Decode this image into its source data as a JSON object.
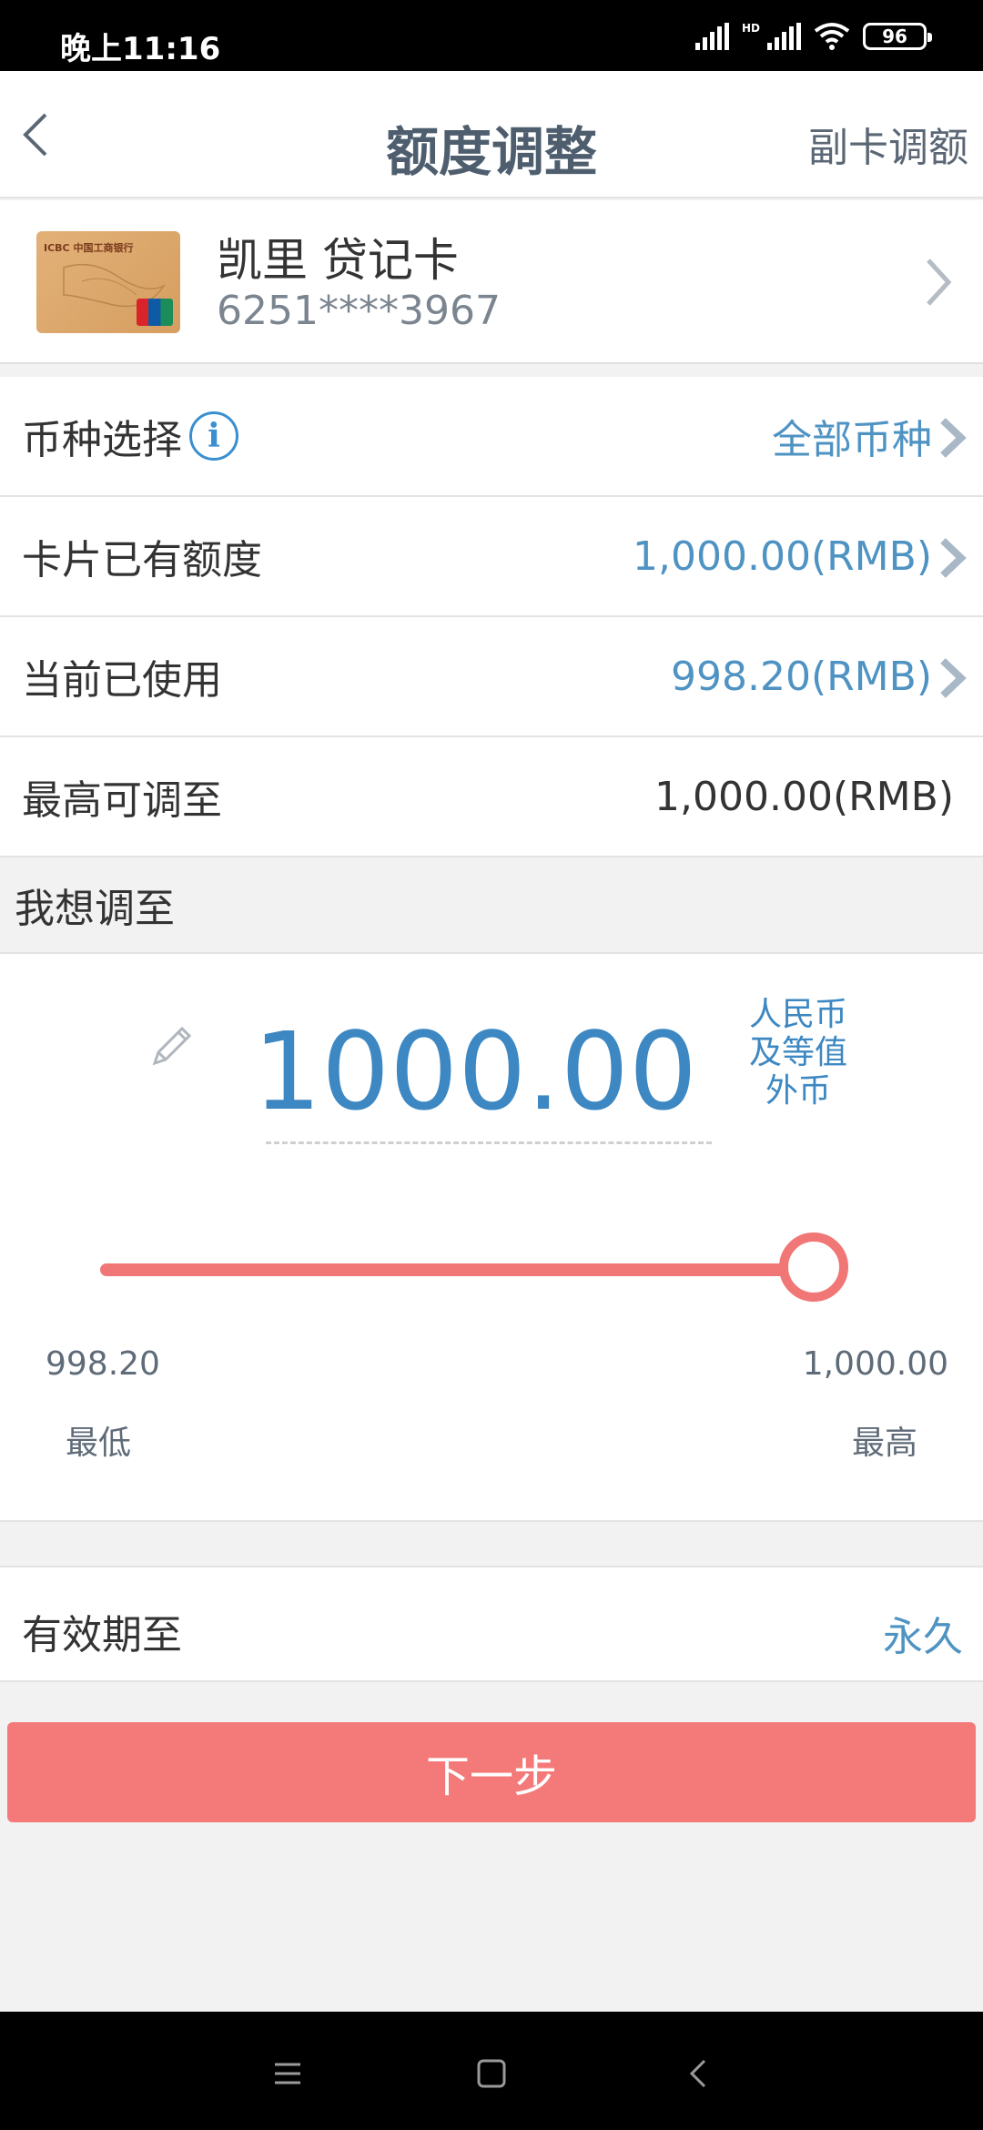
{
  "status_bar": {
    "time": "晚上11:16",
    "hd": "HD",
    "battery": "96"
  },
  "header": {
    "title": "额度调整",
    "right_action": "副卡调额",
    "back_icon": "chevron-left-icon"
  },
  "card": {
    "name": "凯里 贷记卡",
    "number": "6251****3967",
    "brand_text": "ICBC 中国工商银行"
  },
  "rows": [
    {
      "label": "币种选择",
      "value": "全部币种",
      "has_info": true,
      "has_chevron": true
    },
    {
      "label": "卡片已有额度",
      "value": "1,000.00(RMB)",
      "has_chevron": true
    },
    {
      "label": "当前已使用",
      "value": "998.20(RMB)",
      "has_chevron": true
    },
    {
      "label": "最高可调至",
      "value": "1,000.00(RMB)",
      "has_chevron": false
    }
  ],
  "adjust": {
    "section_label": "我想调至",
    "amount": "1000.00",
    "currency_lines": [
      "人民币",
      "及等值",
      "外币"
    ],
    "slider": {
      "min_value": "998.20",
      "max_value": "1,000.00",
      "min_label": "最低",
      "max_label": "最高",
      "position_fraction": 1.0
    }
  },
  "validity": {
    "label": "有效期至",
    "value": "永久"
  },
  "next_button": "下一步",
  "colors": {
    "accent_blue": "#3d88c2",
    "button_red": "#f47a7a",
    "slider_red": "#f17777"
  }
}
